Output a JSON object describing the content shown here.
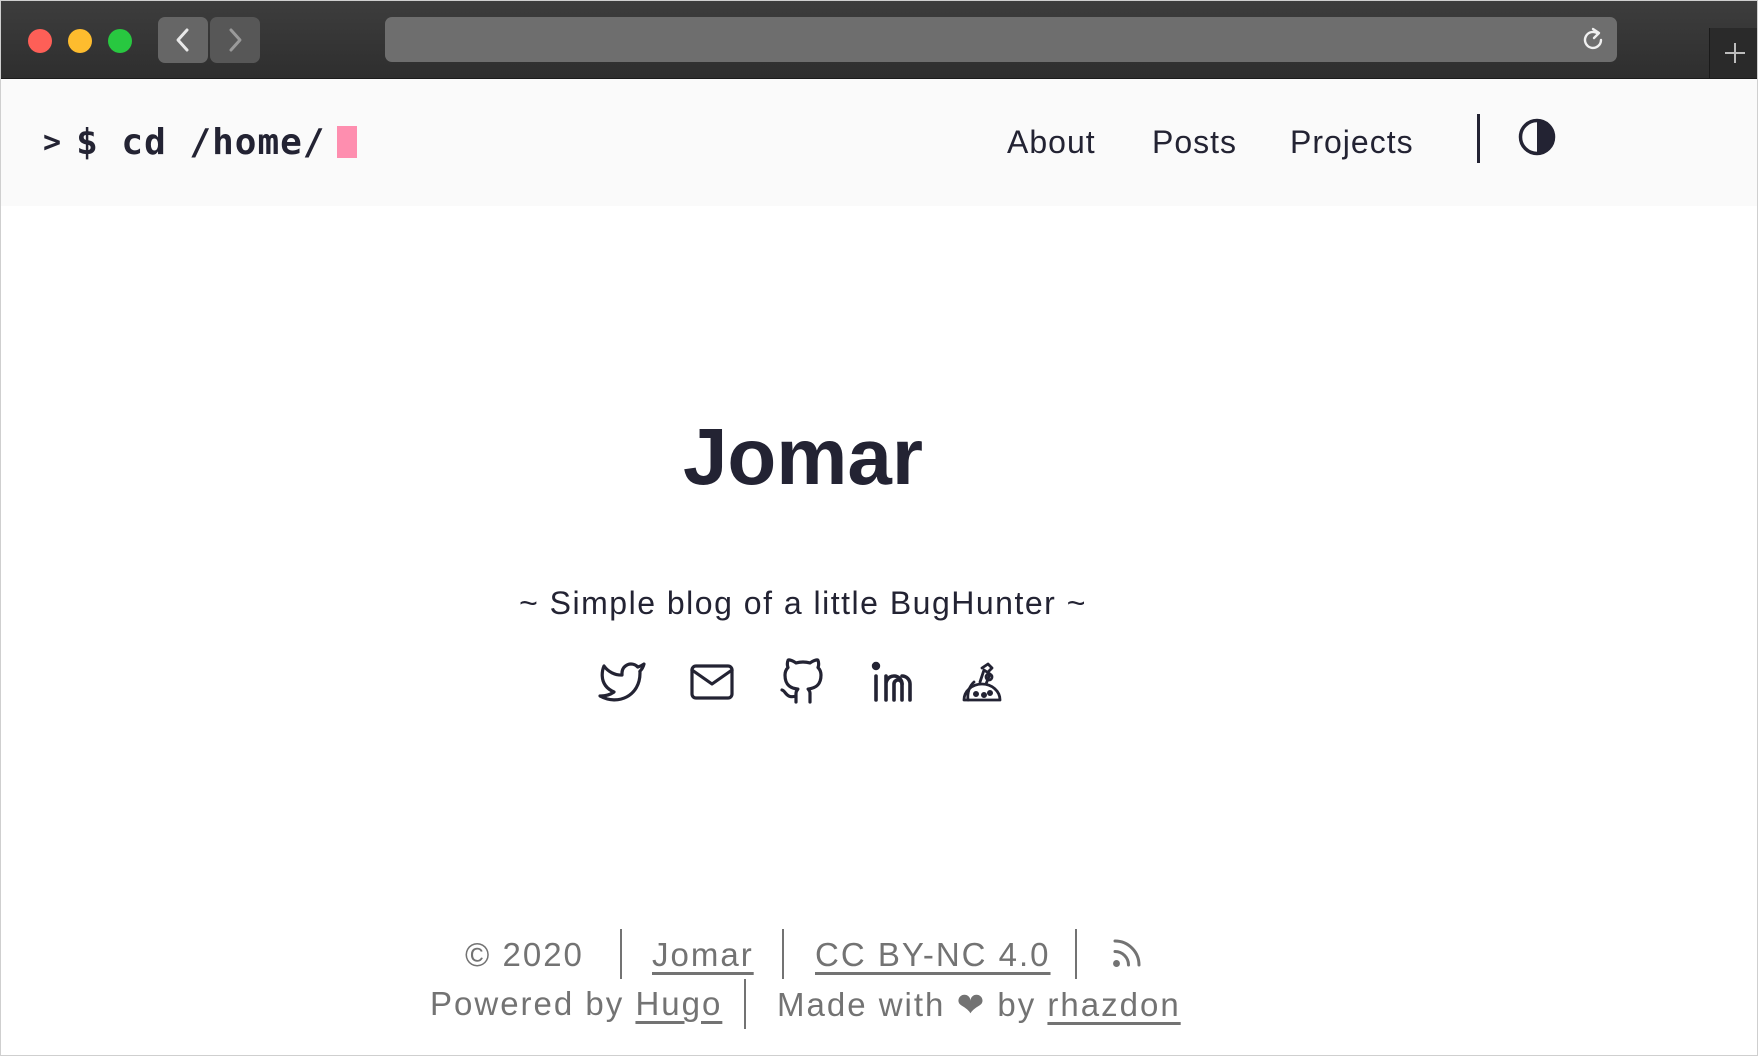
{
  "browser": {
    "back_icon": "chevron-left-icon",
    "forward_icon": "chevron-right-icon",
    "reload_icon": "reload-icon",
    "new_tab_icon": "plus-icon"
  },
  "header": {
    "logo_caret": ">",
    "logo_text": "$ cd /home/",
    "cursor_color": "#fe8eaf",
    "menu": [
      {
        "label": "About"
      },
      {
        "label": "Posts"
      },
      {
        "label": "Projects"
      }
    ],
    "theme_toggle_icon": "half-circle-contrast-icon"
  },
  "main": {
    "title": "Jomar",
    "subtitle": "~ Simple blog of a little BugHunter ~",
    "socials": [
      {
        "icon": "twitter-icon"
      },
      {
        "icon": "mail-icon"
      },
      {
        "icon": "github-icon"
      },
      {
        "icon": "linkedin-icon"
      },
      {
        "icon": "hackerone-icon"
      }
    ]
  },
  "footer": {
    "copyright": "© 2020",
    "author_link": "Jomar",
    "license_link": "CC BY-NC 4.0",
    "rss_icon": "rss-icon",
    "powered_by_prefix": "Powered by",
    "powered_by_link": "Hugo",
    "made_with_prefix": "Made with ❤ by",
    "theme_author_link": "rhazdon"
  },
  "colors": {
    "text": "#232333",
    "muted": "#737373",
    "header_bg": "#fafafa",
    "accent_cursor": "#fe8eaf"
  }
}
